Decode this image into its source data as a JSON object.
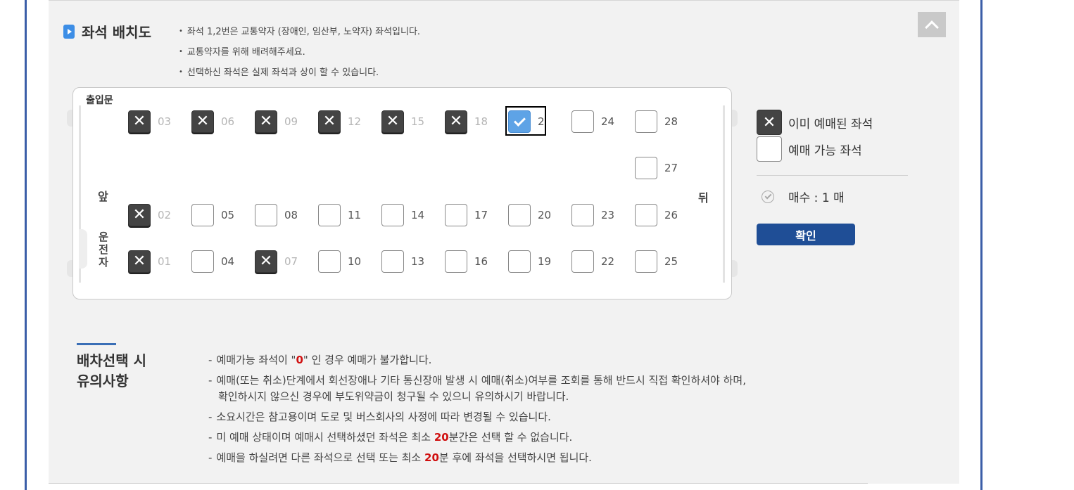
{
  "section": {
    "title": "좌석 배치도",
    "notes": [
      "좌석 1,2번은 교통약자 (장애인, 임산부, 노약자) 좌석입니다.",
      "교통약자를 위해 배려해주세요.",
      "선택하신 좌석은 실제 좌석과 상이 할 수 있습니다."
    ]
  },
  "bus": {
    "door_label": "출입문",
    "front_label": "앞",
    "driver_label": "운전자",
    "back_label": "뒤",
    "rows": [
      [
        {
          "num": "03",
          "status": "taken"
        },
        {
          "num": "06",
          "status": "taken"
        },
        {
          "num": "09",
          "status": "taken"
        },
        {
          "num": "12",
          "status": "taken"
        },
        {
          "num": "15",
          "status": "taken"
        },
        {
          "num": "18",
          "status": "taken"
        },
        {
          "num": "2",
          "status": "selected"
        },
        {
          "num": "24",
          "status": "available"
        },
        {
          "num": "28",
          "status": "available"
        }
      ],
      [
        {
          "num": "27",
          "status": "available"
        }
      ],
      [
        {
          "num": "02",
          "status": "taken"
        },
        {
          "num": "05",
          "status": "available"
        },
        {
          "num": "08",
          "status": "available"
        },
        {
          "num": "11",
          "status": "available"
        },
        {
          "num": "14",
          "status": "available"
        },
        {
          "num": "17",
          "status": "available"
        },
        {
          "num": "20",
          "status": "available"
        },
        {
          "num": "23",
          "status": "available"
        },
        {
          "num": "26",
          "status": "available"
        }
      ],
      [
        {
          "num": "01",
          "status": "taken"
        },
        {
          "num": "04",
          "status": "available"
        },
        {
          "num": "07",
          "status": "taken"
        },
        {
          "num": "10",
          "status": "available"
        },
        {
          "num": "13",
          "status": "available"
        },
        {
          "num": "16",
          "status": "available"
        },
        {
          "num": "19",
          "status": "available"
        },
        {
          "num": "22",
          "status": "available"
        },
        {
          "num": "25",
          "status": "available"
        }
      ]
    ]
  },
  "legend": {
    "taken_label": "이미 예매된 좌석",
    "available_label": "예매 가능 좌석",
    "count_label": "매수 : 1 매",
    "confirm_label": "확인"
  },
  "notice": {
    "title_line1": "배차선택 시",
    "title_line2": "유의사항",
    "items": [
      {
        "dash": "-",
        "a": "예매가능 좌석이 \"",
        "hl": "0",
        "b": "\" 인 경우 예매가 불가합니다.",
        "cont": ""
      },
      {
        "dash": "-",
        "a": "예매(또는 취소)단계에서 회선장애나 기타 통신장애 발생 시 예매(취소)여부를 조회를 통해 반드시 직접 확인하셔야 하며,",
        "hl": "",
        "b": "",
        "cont": "확인하시지 않으신 경우에 부도위약금이 청구될 수 있으니 유의하시기 바랍니다."
      },
      {
        "dash": "-",
        "a": "소요시간은 참고용이며 도로 및 버스회사의 사정에 따라 변경될 수 있습니다.",
        "hl": "",
        "b": "",
        "cont": ""
      },
      {
        "dash": "-",
        "a": "미 예매 상태이며 예매시 선택하셨던 좌석은 최소 ",
        "hl": "20",
        "b": "분간은 선택 할 수 없습니다.",
        "cont": ""
      },
      {
        "dash": "-",
        "a": "예매을 하실려면 다른 좌석으로 선택 또는 최소 ",
        "hl": "20",
        "b": "분 후에 좌석을 선택하시면 됩니다.",
        "cont": ""
      }
    ]
  }
}
